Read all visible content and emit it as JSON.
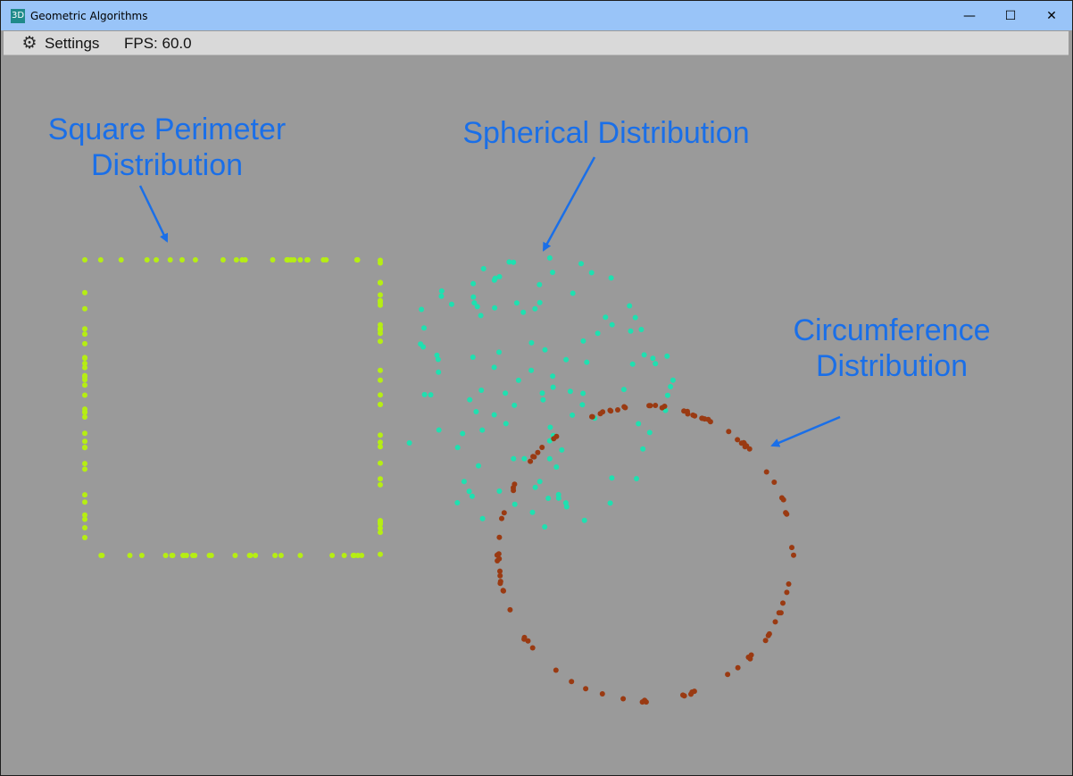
{
  "window": {
    "title": "Geometric Algorithms",
    "app_icon_text": "3D",
    "controls": {
      "minimize": "—",
      "maximize": "☐",
      "close": "✕"
    }
  },
  "menubar": {
    "settings_icon": "gear-icon",
    "settings_label": "Settings",
    "fps_text": "FPS: 60.0"
  },
  "annotations": {
    "square": [
      "Square Perimeter",
      "Distribution"
    ],
    "spherical": [
      "Spherical Distribution"
    ],
    "circumference": [
      "Circumference",
      "Distribution"
    ]
  },
  "colors": {
    "background": "#9a9a9a",
    "annotation": "#1a6fe8",
    "square_points": "#b6ee13",
    "sphere_points": "#1fe0b0",
    "circle_points": "#9a3a12"
  }
}
